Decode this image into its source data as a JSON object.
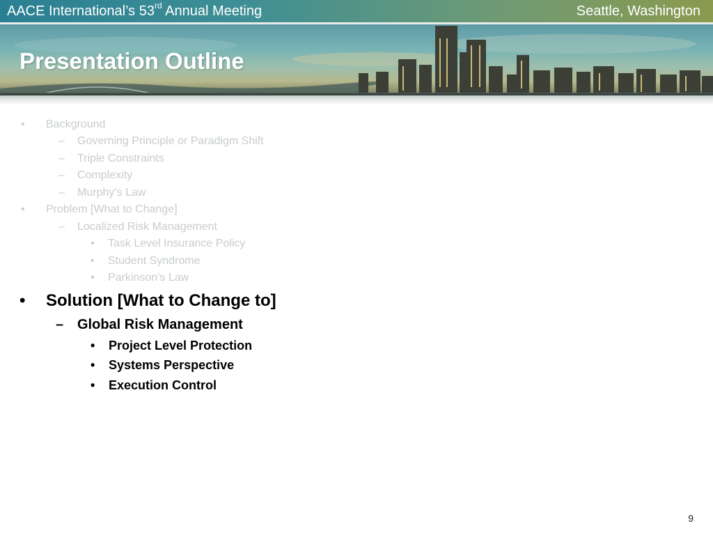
{
  "header": {
    "event_prefix": "AACE International’s 53",
    "event_superscript": "rd",
    "event_suffix": " Annual Meeting",
    "location": "Seattle, Washington"
  },
  "slide": {
    "title": "Presentation Outline",
    "page_number": "9"
  },
  "outline": {
    "inactive": [
      {
        "bullet": "•",
        "text": "Background"
      },
      {
        "bullet": "–",
        "text": "Governing Principle or Paradigm Shift"
      },
      {
        "bullet": "–",
        "text": "Triple Constraints"
      },
      {
        "bullet": "–",
        "text": "Complexity"
      },
      {
        "bullet": "–",
        "text": "Murphy’s Law"
      },
      {
        "bullet": "•",
        "text": "Problem [What to Change]"
      },
      {
        "bullet": "–",
        "text": "Localized Risk Management"
      },
      {
        "bullet": "•",
        "text": "Task Level Insurance Policy"
      },
      {
        "bullet": "•",
        "text": "Student Syndrome"
      },
      {
        "bullet": "•",
        "text": "Parkinson’s Law"
      }
    ],
    "active": [
      {
        "bullet": "•",
        "text": "Solution [What to Change to]"
      },
      {
        "bullet": "–",
        "text": "Global Risk Management"
      },
      {
        "bullet": "•",
        "text": "Project Level Protection"
      },
      {
        "bullet": "•",
        "text": "Systems Perspective"
      },
      {
        "bullet": "•",
        "text": "Execution Control"
      }
    ]
  },
  "colors": {
    "inactive_text": "#c8cccc",
    "active_text": "#000000",
    "header_text": "#ffffff"
  }
}
